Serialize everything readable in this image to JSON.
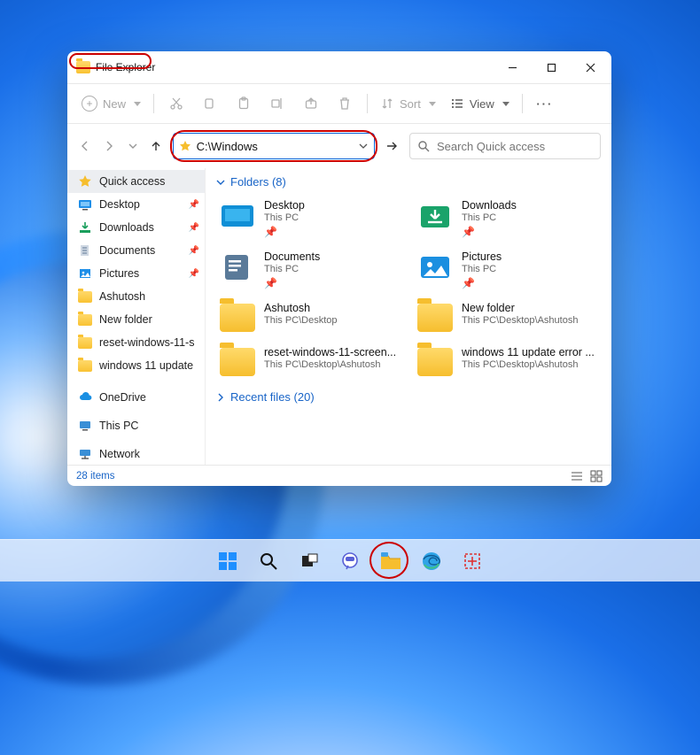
{
  "window": {
    "title": "File Explorer",
    "controls": {
      "min": "Minimize",
      "max": "Maximize",
      "close": "Close"
    }
  },
  "toolbar": {
    "new_label": "New",
    "sort_label": "Sort",
    "view_label": "View"
  },
  "address": {
    "value": "C:\\Windows",
    "dropdown_visible": true
  },
  "search": {
    "placeholder": "Search Quick access"
  },
  "sidebar": {
    "items": [
      {
        "label": "Quick access",
        "pinned": false,
        "icon": "star",
        "active": true
      },
      {
        "label": "Desktop",
        "pinned": true,
        "icon": "desktop"
      },
      {
        "label": "Downloads",
        "pinned": true,
        "icon": "downloads"
      },
      {
        "label": "Documents",
        "pinned": true,
        "icon": "documents"
      },
      {
        "label": "Pictures",
        "pinned": true,
        "icon": "pictures"
      },
      {
        "label": "Ashutosh",
        "pinned": false,
        "icon": "folder"
      },
      {
        "label": "New folder",
        "pinned": false,
        "icon": "folder"
      },
      {
        "label": "reset-windows-11-s",
        "pinned": false,
        "icon": "folder"
      },
      {
        "label": "windows 11 update",
        "pinned": false,
        "icon": "folder"
      }
    ],
    "roots": [
      {
        "label": "OneDrive",
        "icon": "onedrive"
      },
      {
        "label": "This PC",
        "icon": "thispc"
      },
      {
        "label": "Network",
        "icon": "network"
      }
    ]
  },
  "content": {
    "folders_header": "Folders (8)",
    "recent_header": "Recent files (20)",
    "folders": [
      {
        "name": "Desktop",
        "loc": "This PC",
        "pinned": true,
        "icon": "desktop-big"
      },
      {
        "name": "Downloads",
        "loc": "This PC",
        "pinned": true,
        "icon": "downloads-big"
      },
      {
        "name": "Documents",
        "loc": "This PC",
        "pinned": true,
        "icon": "documents-big"
      },
      {
        "name": "Pictures",
        "loc": "This PC",
        "pinned": true,
        "icon": "pictures-big"
      },
      {
        "name": "Ashutosh",
        "loc": "This PC\\Desktop",
        "pinned": false,
        "icon": "folder-big"
      },
      {
        "name": "New folder",
        "loc": "This PC\\Desktop\\Ashutosh",
        "pinned": false,
        "icon": "folder-big"
      },
      {
        "name": "reset-windows-11-screen...",
        "loc": "This PC\\Desktop\\Ashutosh",
        "pinned": false,
        "icon": "folder-big"
      },
      {
        "name": "windows 11 update error ...",
        "loc": "This PC\\Desktop\\Ashutosh",
        "pinned": false,
        "icon": "folder-big"
      }
    ]
  },
  "status": {
    "text": "28 items"
  },
  "taskbar": {
    "items": [
      "start",
      "search",
      "taskview",
      "chat",
      "explorer",
      "edge",
      "snip"
    ]
  }
}
